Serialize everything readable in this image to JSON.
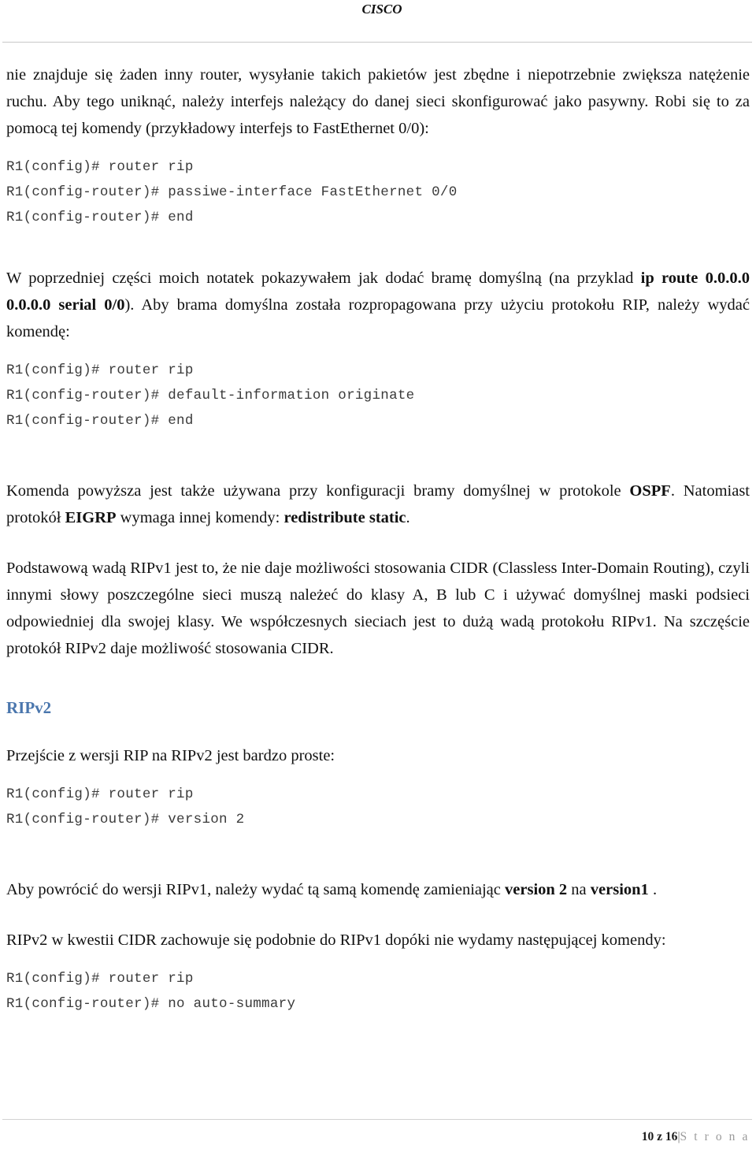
{
  "header": {
    "title": "CISCO"
  },
  "body": {
    "paragraph_1": {
      "text": "nie znajduje się żaden inny router, wysyłanie takich pakietów jest zbędne i niepotrzebnie zwiększa natężenie ruchu. Aby tego uniknąć, należy interfejs należący do danej sieci skonfigurować jako pasywny. Robi się to za pomocą tej komendy (przykładowy interfejs to FastEthernet 0/0):"
    },
    "code_block_1": {
      "lines": [
        "R1(config)# router rip",
        "R1(config-router)# passiwe-interface FastEthernet 0/0",
        "R1(config-router)# end"
      ]
    },
    "paragraph_2": {
      "part_1": "W poprzedniej części moich notatek pokazywałem jak dodać bramę domyślną (na przyklad ",
      "bold_1": "ip route 0.0.0.0 0.0.0.0 serial 0/0",
      "part_2": "). Aby brama domyślna została rozpropagowana przy użyciu protokołu RIP, należy wydać komendę:"
    },
    "code_block_2": {
      "lines": [
        "R1(config)# router rip",
        "R1(config-router)# default-information originate",
        "R1(config-router)# end"
      ]
    },
    "paragraph_3": {
      "part_1": "Komenda powyższa jest także używana przy konfiguracji bramy domyślnej w protokole ",
      "bold_1": "OSPF",
      "part_2": ". Natomiast protokół ",
      "bold_2": "EIGRP",
      "part_3": " wymaga innej komendy: ",
      "bold_3": "redistribute static",
      "part_4": "."
    },
    "paragraph_4": {
      "text": "Podstawową wadą RIPv1 jest to, że nie daje możliwości stosowania CIDR (Classless Inter-Domain Routing), czyli innymi słowy poszczególne sieci muszą należeć do klasy A, B lub C i używać domyślnej maski podsieci odpowiedniej dla swojej klasy. We współczesnych sieciach jest to dużą wadą protokołu RIPv1. Na szczęście protokół RIPv2 daje możliwość stosowania CIDR."
    },
    "heading_ripv2": {
      "text": "RIPv2",
      "color": "#4a76ad"
    },
    "paragraph_5": {
      "text": "Przejście z wersji RIP na RIPv2 jest bardzo proste:"
    },
    "code_block_3": {
      "lines": [
        "R1(config)# router rip",
        "R1(config-router)# version 2"
      ]
    },
    "paragraph_6": {
      "part_1": "Aby powrócić do wersji RIPv1, należy wydać tą samą komendę zamieniając ",
      "bold_1": "version 2",
      "part_2": " na ",
      "bold_2": "version1",
      "part_3": " ."
    },
    "paragraph_7": {
      "text": "RIPv2 w kwestii CIDR zachowuje się podobnie do RIPv1 dopóki nie wydamy następującej komendy:"
    },
    "code_block_4": {
      "lines": [
        "R1(config)# router rip",
        "R1(config-router)# no auto-summary"
      ]
    }
  },
  "footer": {
    "page_number": "10 z 16",
    "separator": "|",
    "label": "S t r o n a"
  }
}
